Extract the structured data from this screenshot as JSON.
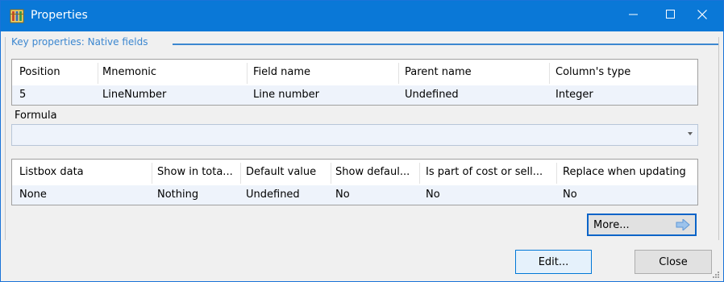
{
  "window": {
    "title": "Properties"
  },
  "group": {
    "title": "Key properties: Native fields"
  },
  "table1": {
    "columns": [
      "Position",
      "Mnemonic",
      "Field name",
      "Parent name",
      "Column's type"
    ],
    "row": [
      "5",
      "LineNumber",
      "Line number",
      "Undefined",
      "Integer"
    ]
  },
  "formula": {
    "label": "Formula",
    "value": ""
  },
  "table2": {
    "columns": [
      "Listbox data",
      "Show in tota...",
      "Default value",
      "Show defaul...",
      "Is part of cost or sell...",
      "Replace when updating"
    ],
    "row": [
      "None",
      "Nothing",
      "Undefined",
      "No",
      "No",
      "No"
    ]
  },
  "buttons": {
    "more": "More...",
    "edit": "Edit...",
    "close": "Close"
  },
  "icons": {
    "app": "table-app-icon",
    "minimize": "minimize-icon",
    "maximize": "maximize-icon",
    "close": "close-icon",
    "more_arrow": "arrow-right-icon"
  },
  "colors": {
    "titlebar": "#0a78d7",
    "accent": "#3c87d0"
  }
}
